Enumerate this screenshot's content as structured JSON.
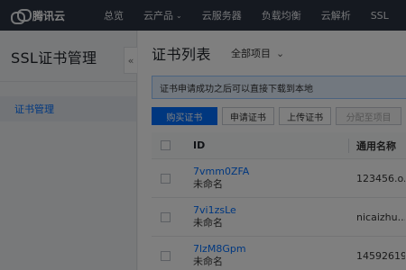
{
  "topbar": {
    "logo_text": "腾讯云",
    "nav": [
      {
        "label": "总览",
        "has_dropdown": false
      },
      {
        "label": "云产品",
        "has_dropdown": true
      },
      {
        "label": "云服务器",
        "has_dropdown": false
      },
      {
        "label": "负载均衡",
        "has_dropdown": false
      },
      {
        "label": "云解析",
        "has_dropdown": false
      },
      {
        "label": "SSL",
        "has_dropdown": false
      }
    ]
  },
  "sidebar": {
    "title": "SSL证书管理",
    "items": [
      {
        "label": "证书管理",
        "active": true
      }
    ],
    "collapse_icon": "chevron-left-icon"
  },
  "main": {
    "title": "证书列表",
    "project_select": {
      "value": "全部项目"
    },
    "notice": "证书申请成功之后可以直接下载到本地",
    "toolbar": {
      "buy": "购买证书",
      "apply": "申请证书",
      "upload": "上传证书",
      "assign": "分配至项目"
    },
    "table": {
      "columns": [
        "ID",
        "通用名称"
      ],
      "rows": [
        {
          "id": "7vmm0ZFA",
          "sub": "未命名",
          "name": "123456.o..."
        },
        {
          "id": "7vi1zsLe",
          "sub": "未命名",
          "name": "nicaizhu..."
        },
        {
          "id": "7lzM8Gpm",
          "sub": "未命名",
          "name": "14592619..."
        }
      ]
    }
  },
  "colors": {
    "topbar_bg": "#2b3340",
    "accent": "#006eff",
    "notice_bg": "#e5f0ff"
  }
}
